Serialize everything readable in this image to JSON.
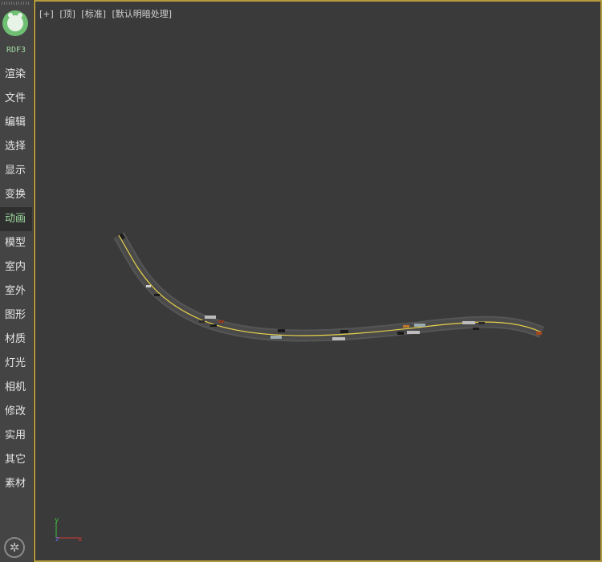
{
  "sidebar": {
    "brand": "RDF3",
    "items": [
      {
        "label": "渲染"
      },
      {
        "label": "文件"
      },
      {
        "label": "编辑"
      },
      {
        "label": "选择"
      },
      {
        "label": "显示"
      },
      {
        "label": "变换"
      },
      {
        "label": "动画",
        "active": true
      },
      {
        "label": "模型"
      },
      {
        "label": "室内"
      },
      {
        "label": "室外"
      },
      {
        "label": "图形"
      },
      {
        "label": "材质"
      },
      {
        "label": "灯光"
      },
      {
        "label": "相机"
      },
      {
        "label": "修改"
      },
      {
        "label": "实用"
      },
      {
        "label": "其它"
      },
      {
        "label": "素材"
      }
    ]
  },
  "viewport": {
    "plus_label": "[+]",
    "view_label": "[顶]",
    "shading_label": "[标准]",
    "lighting_label": "[默认明暗处理]"
  },
  "gizmo": {
    "y_label": "y",
    "z_label": "z",
    "x_label": "x"
  },
  "colors": {
    "accent_green": "#9ed89e",
    "viewport_border": "#b49a3c",
    "road_centerline": "#e8d24a"
  }
}
